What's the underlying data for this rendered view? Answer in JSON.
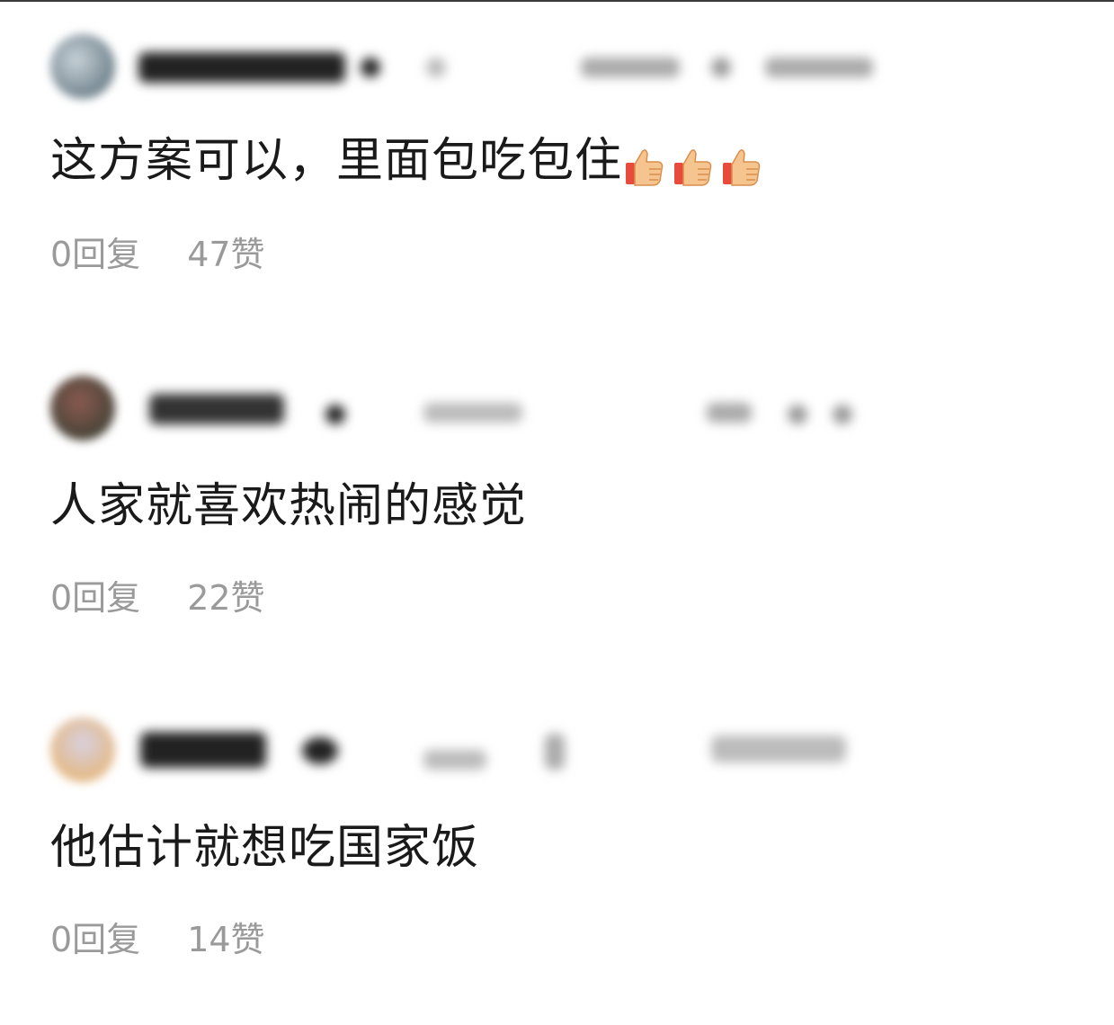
{
  "comments": [
    {
      "text": "这方案可以，里面包吃包住",
      "emoji": [
        "thumbs-up",
        "thumbs-up",
        "thumbs-up"
      ],
      "replies": "0回复",
      "likes": "47赞"
    },
    {
      "text": "人家就喜欢热闹的感觉",
      "replies": "0回复",
      "likes": "22赞"
    },
    {
      "text": "他估计就想吃国家饭",
      "replies": "0回复",
      "likes": "14赞"
    }
  ],
  "colors": {
    "comment_text": "#1a1a1a",
    "stats_text": "#9a9a9a",
    "background": "#ffffff"
  }
}
